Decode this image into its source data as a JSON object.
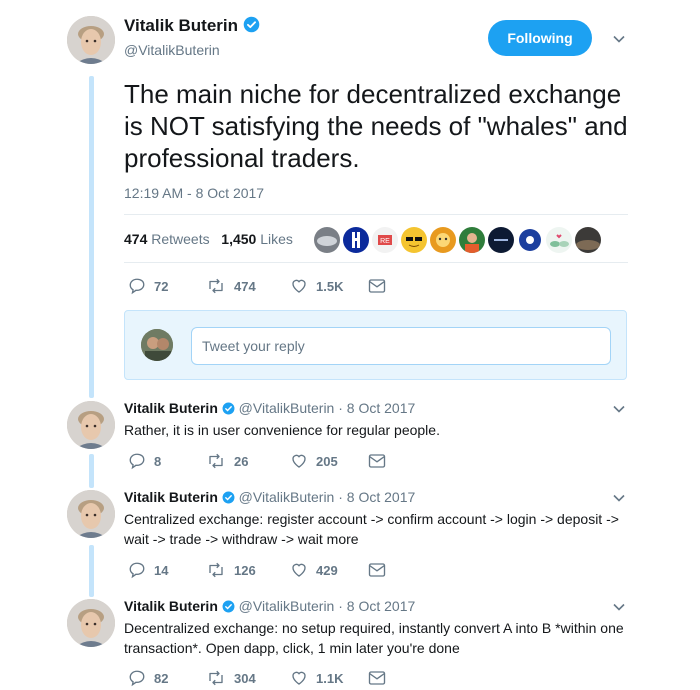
{
  "tweet": {
    "author_name": "Vitalik Buterin",
    "handle": "@VitalikButerin",
    "follow_label": "Following",
    "text": "The main niche for decentralized exchange is NOT satisfying the needs of \"whales\" and professional traders.",
    "timestamp": "12:19 AM - 8 Oct 2017",
    "retweets_count": "474",
    "retweets_label": "Retweets",
    "likes_count": "1,450",
    "likes_label": "Likes",
    "actions": {
      "replies": "72",
      "retweets": "474",
      "likes": "1.5K"
    }
  },
  "reply_box": {
    "placeholder": "Tweet your reply"
  },
  "replies": [
    {
      "author_name": "Vitalik Buterin",
      "meta": "@VitalikButerin · 8 Oct 2017",
      "text": "Rather, it is in user convenience for regular people.",
      "replies": "8",
      "retweets": "26",
      "likes": "205"
    },
    {
      "author_name": "Vitalik Buterin",
      "meta": "@VitalikButerin · 8 Oct 2017",
      "text": "Centralized exchange: register account -> confirm account -> login -> deposit -> wait -> trade -> withdraw -> wait more",
      "replies": "14",
      "retweets": "126",
      "likes": "429"
    },
    {
      "author_name": "Vitalik Buterin",
      "meta": "@VitalikButerin · 8 Oct 2017",
      "text": "Decentralized exchange: no setup required, instantly convert A into B *within one transaction*. Open dapp, click, 1 min later you're done",
      "replies": "82",
      "retweets": "304",
      "likes": "1.1K"
    }
  ],
  "colors": {
    "accent": "#1da1f2",
    "muted": "#657786",
    "thread_line": "#c4e4fb"
  },
  "icons": [
    "verified-icon",
    "chevron-down-icon",
    "reply-icon",
    "retweet-icon",
    "heart-icon",
    "message-icon"
  ]
}
